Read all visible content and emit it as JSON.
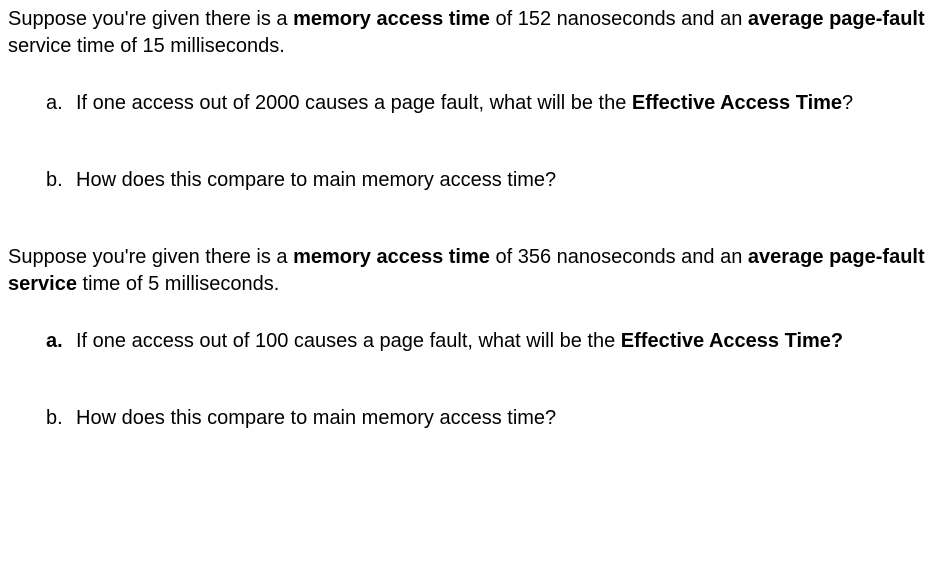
{
  "block1": {
    "intro": {
      "part1": "Suppose you're given there is a ",
      "bold1": "memory access time",
      "part2": " of 152 nanoseconds and an ",
      "bold2": "average page-fault",
      "part3": " service time of 15 milliseconds."
    },
    "items": [
      {
        "marker": "a.",
        "markerBold": false,
        "part1": "If one access out of 2000 causes a page fault, what will be the ",
        "bold1": "Effective Access Time",
        "part2": "?"
      },
      {
        "marker": "b.",
        "markerBold": false,
        "part1": "How does this compare to main memory access time?",
        "bold1": "",
        "part2": ""
      }
    ]
  },
  "block2": {
    "intro": {
      "part1": "Suppose you're given there is a ",
      "bold1": "memory access time",
      "part2": " of 356 nanoseconds and an ",
      "bold2": "average page-fault service",
      "part3": " time of 5 milliseconds."
    },
    "items": [
      {
        "marker": "a.",
        "markerBold": true,
        "part1": "If one access out of 100 causes a page fault, what will be the ",
        "bold1": "Effective Access Time?",
        "part2": ""
      },
      {
        "marker": "b.",
        "markerBold": false,
        "part1": "How does this compare to main memory access time?",
        "bold1": "",
        "part2": ""
      }
    ]
  }
}
